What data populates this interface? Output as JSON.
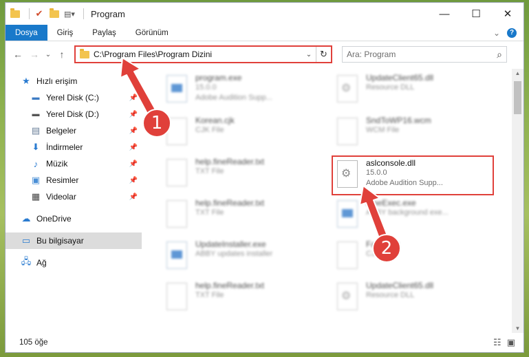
{
  "window": {
    "title": "Program",
    "controls": {
      "minimize": "—",
      "maximize": "☐",
      "close": "✕"
    }
  },
  "ribbon": {
    "tabs": [
      {
        "label": "Dosya",
        "active": true
      },
      {
        "label": "Giriş"
      },
      {
        "label": "Paylaş"
      },
      {
        "label": "Görünüm"
      }
    ],
    "expand_glyph": "⌄",
    "help_glyph": "?"
  },
  "navigation": {
    "back": "←",
    "forward": "→",
    "recent": "⌄",
    "up": "↑",
    "address": "C:\\Program Files\\Program Dizini",
    "dropdown": "⌄",
    "refresh": "↻",
    "search_placeholder": "Ara: Program",
    "search_icon": "⌕"
  },
  "sidebar": {
    "quick_access": "Hızlı erişim",
    "items": [
      {
        "label": "Yerel Disk (C:)",
        "icon": "drive-icon"
      },
      {
        "label": "Yerel Disk (D:)",
        "icon": "drive-icon"
      },
      {
        "label": "Belgeler",
        "icon": "documents-icon"
      },
      {
        "label": "İndirmeler",
        "icon": "downloads-icon"
      },
      {
        "label": "Müzik",
        "icon": "music-icon"
      },
      {
        "label": "Resimler",
        "icon": "pictures-icon"
      },
      {
        "label": "Videolar",
        "icon": "videos-icon"
      }
    ],
    "onedrive": "OneDrive",
    "this_pc": "Bu bilgisayar",
    "network": "Ağ"
  },
  "files": [
    {
      "name": "program.exe",
      "line2": "15.0.0",
      "line3": "Adobe Audition Supp...",
      "icon": "app"
    },
    {
      "name": "UpdateClient65.dll",
      "line2": "Resource DLL",
      "line3": "",
      "icon": "gear"
    },
    {
      "name": "Korean.cjk",
      "line2": "CJK File",
      "line3": "",
      "icon": "blank"
    },
    {
      "name": "SndToWP16.wcm",
      "line2": "WCM File",
      "line3": "",
      "icon": "blank"
    },
    {
      "name": "help.fineReader.txt",
      "line2": "TXT File",
      "line3": "",
      "icon": "blank"
    },
    {
      "name": "aslconsole.dll",
      "line2": "15.0.0",
      "line3": "Adobe Audition Supp...",
      "icon": "gear"
    },
    {
      "name": "help.fineReader.txt",
      "line2": "TXT File",
      "line3": "",
      "icon": "blank"
    },
    {
      "name": "FineExec.exe",
      "line2": "ABBY background exe...",
      "line3": "",
      "icon": "win"
    },
    {
      "name": "UpdateInstaller.exe",
      "line2": "ABBY updates installer",
      "line3": "",
      "icon": "win"
    },
    {
      "name": "Fan....cjk",
      "line2": "CJK",
      "line3": "",
      "icon": "blank"
    },
    {
      "name": "help.fineReader.txt",
      "line2": "TXT File",
      "line3": "",
      "icon": "blank"
    },
    {
      "name": "UpdateClient65.dll",
      "line2": "Resource DLL",
      "line3": "",
      "icon": "gear"
    }
  ],
  "status": {
    "count": "105 öğe"
  },
  "annotations": {
    "step1": "1",
    "step2": "2",
    "accent": "#e0403a"
  }
}
